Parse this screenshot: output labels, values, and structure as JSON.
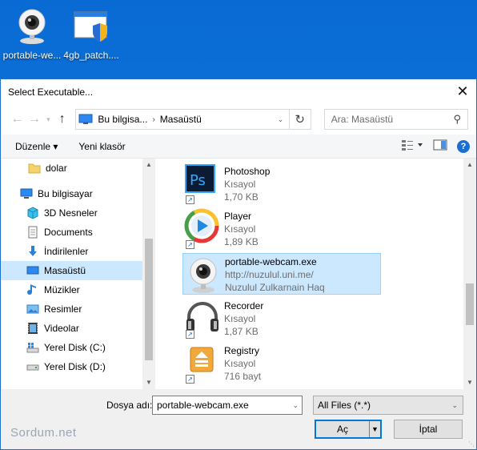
{
  "desktop": {
    "icons": [
      {
        "label": "portable-we...",
        "icon": "webcam-icon"
      },
      {
        "label": "4gb_patch....",
        "icon": "shield-window-icon"
      }
    ]
  },
  "dialog": {
    "title": "Select Executable...",
    "close": "✕",
    "nav": {
      "breadcrumb": [
        "Bu bilgisa...",
        "Masaüstü"
      ],
      "search_placeholder": "Ara: Masaüstü"
    },
    "toolbar": {
      "organize": "Düzenle ▾",
      "new_folder": "Yeni klasör",
      "help": "?"
    },
    "sidebar": [
      {
        "label": "dolar",
        "icon": "folder-icon"
      },
      {
        "label": "Bu bilgisayar",
        "icon": "computer-icon"
      },
      {
        "label": "3D Nesneler",
        "icon": "cube-icon"
      },
      {
        "label": "Documents",
        "icon": "document-icon"
      },
      {
        "label": "İndirilenler",
        "icon": "download-icon"
      },
      {
        "label": "Masaüstü",
        "icon": "desktop-icon",
        "selected": true
      },
      {
        "label": "Müzikler",
        "icon": "music-icon"
      },
      {
        "label": "Resimler",
        "icon": "pictures-icon"
      },
      {
        "label": "Videolar",
        "icon": "video-icon"
      },
      {
        "label": "Yerel Disk (C:)",
        "icon": "windows-drive-icon"
      },
      {
        "label": "Yerel Disk (D:)",
        "icon": "drive-icon"
      }
    ],
    "files": [
      {
        "name": "Photoshop",
        "line2": "Kısayol",
        "line3": "1,70 KB",
        "icon": "photoshop-icon"
      },
      {
        "name": "Player",
        "line2": "Kısayol",
        "line3": "1,89 KB",
        "icon": "media-player-icon"
      },
      {
        "name": "portable-webcam.exe",
        "line2": "http://nuzulul.uni.me/",
        "line3": "Nuzulul Zulkarnain Haq",
        "icon": "webcam-icon",
        "selected": true
      },
      {
        "name": "Recorder",
        "line2": "Kısayol",
        "line3": "1,87 KB",
        "icon": "headphones-icon"
      },
      {
        "name": "Registry",
        "line2": "Kısayol",
        "line3": "716 bayt",
        "icon": "registry-icon"
      }
    ],
    "bottom": {
      "filename_label": "Dosya adı:",
      "filename_value": "portable-webcam.exe",
      "filter_value": "All Files (*.*)",
      "open_label": "Aç",
      "cancel_label": "İptal"
    }
  },
  "watermark": "Sordum.net"
}
